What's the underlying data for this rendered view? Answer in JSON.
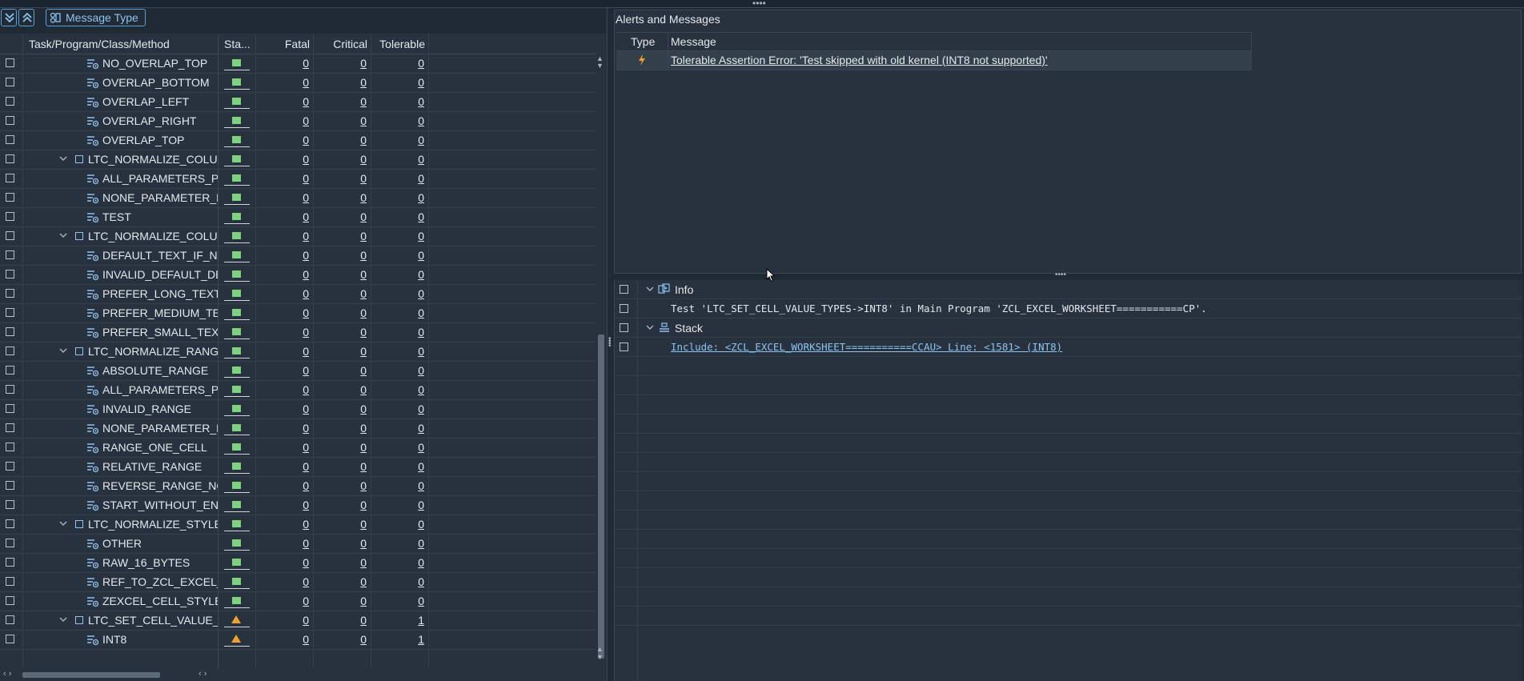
{
  "toolbar": {
    "expand_all_tooltip": "Expand all",
    "collapse_all_tooltip": "Collapse all",
    "message_type_label": "Message Type"
  },
  "tree": {
    "columns": {
      "task": "Task/Program/Class/Method",
      "status": "Sta...",
      "fatal": "Fatal",
      "critical": "Critical",
      "tolerable": "Tolerable"
    },
    "rows": [
      {
        "name": "NO_OVERLAP_TOP",
        "kind": "method",
        "status": "ok",
        "fatal": "0",
        "critical": "0",
        "tolerable": "0"
      },
      {
        "name": "OVERLAP_BOTTOM",
        "kind": "method",
        "status": "ok",
        "fatal": "0",
        "critical": "0",
        "tolerable": "0"
      },
      {
        "name": "OVERLAP_LEFT",
        "kind": "method",
        "status": "ok",
        "fatal": "0",
        "critical": "0",
        "tolerable": "0"
      },
      {
        "name": "OVERLAP_RIGHT",
        "kind": "method",
        "status": "ok",
        "fatal": "0",
        "critical": "0",
        "tolerable": "0"
      },
      {
        "name": "OVERLAP_TOP",
        "kind": "method",
        "status": "ok",
        "fatal": "0",
        "critical": "0",
        "tolerable": "0"
      },
      {
        "name": "LTC_NORMALIZE_COLUM",
        "kind": "class",
        "status": "ok",
        "fatal": "0",
        "critical": "0",
        "tolerable": "0"
      },
      {
        "name": "ALL_PARAMETERS_PA",
        "kind": "method",
        "status": "ok",
        "fatal": "0",
        "critical": "0",
        "tolerable": "0"
      },
      {
        "name": "NONE_PARAMETER_P",
        "kind": "method",
        "status": "ok",
        "fatal": "0",
        "critical": "0",
        "tolerable": "0"
      },
      {
        "name": "TEST",
        "kind": "method",
        "status": "ok",
        "fatal": "0",
        "critical": "0",
        "tolerable": "0"
      },
      {
        "name": "LTC_NORMALIZE_COLUM",
        "kind": "class",
        "status": "ok",
        "fatal": "0",
        "critical": "0",
        "tolerable": "0"
      },
      {
        "name": "DEFAULT_TEXT_IF_NO",
        "kind": "method",
        "status": "ok",
        "fatal": "0",
        "critical": "0",
        "tolerable": "0"
      },
      {
        "name": "INVALID_DEFAULT_DE",
        "kind": "method",
        "status": "ok",
        "fatal": "0",
        "critical": "0",
        "tolerable": "0"
      },
      {
        "name": "PREFER_LONG_TEXT",
        "kind": "method",
        "status": "ok",
        "fatal": "0",
        "critical": "0",
        "tolerable": "0"
      },
      {
        "name": "PREFER_MEDIUM_TEX",
        "kind": "method",
        "status": "ok",
        "fatal": "0",
        "critical": "0",
        "tolerable": "0"
      },
      {
        "name": "PREFER_SMALL_TEXT",
        "kind": "method",
        "status": "ok",
        "fatal": "0",
        "critical": "0",
        "tolerable": "0"
      },
      {
        "name": "LTC_NORMALIZE_RANGE",
        "kind": "class",
        "status": "ok",
        "fatal": "0",
        "critical": "0",
        "tolerable": "0"
      },
      {
        "name": "ABSOLUTE_RANGE",
        "kind": "method",
        "status": "ok",
        "fatal": "0",
        "critical": "0",
        "tolerable": "0"
      },
      {
        "name": "ALL_PARAMETERS_PA",
        "kind": "method",
        "status": "ok",
        "fatal": "0",
        "critical": "0",
        "tolerable": "0"
      },
      {
        "name": "INVALID_RANGE",
        "kind": "method",
        "status": "ok",
        "fatal": "0",
        "critical": "0",
        "tolerable": "0"
      },
      {
        "name": "NONE_PARAMETER_P",
        "kind": "method",
        "status": "ok",
        "fatal": "0",
        "critical": "0",
        "tolerable": "0"
      },
      {
        "name": "RANGE_ONE_CELL",
        "kind": "method",
        "status": "ok",
        "fatal": "0",
        "critical": "0",
        "tolerable": "0"
      },
      {
        "name": "RELATIVE_RANGE",
        "kind": "method",
        "status": "ok",
        "fatal": "0",
        "critical": "0",
        "tolerable": "0"
      },
      {
        "name": "REVERSE_RANGE_NOT",
        "kind": "method",
        "status": "ok",
        "fatal": "0",
        "critical": "0",
        "tolerable": "0"
      },
      {
        "name": "START_WITHOUT_END",
        "kind": "method",
        "status": "ok",
        "fatal": "0",
        "critical": "0",
        "tolerable": "0"
      },
      {
        "name": "LTC_NORMALIZE_STYLE",
        "kind": "class",
        "status": "ok",
        "fatal": "0",
        "critical": "0",
        "tolerable": "0"
      },
      {
        "name": "OTHER",
        "kind": "method",
        "status": "ok",
        "fatal": "0",
        "critical": "0",
        "tolerable": "0"
      },
      {
        "name": "RAW_16_BYTES",
        "kind": "method",
        "status": "ok",
        "fatal": "0",
        "critical": "0",
        "tolerable": "0"
      },
      {
        "name": "REF_TO_ZCL_EXCEL_S",
        "kind": "method",
        "status": "ok",
        "fatal": "0",
        "critical": "0",
        "tolerable": "0"
      },
      {
        "name": "ZEXCEL_CELL_STYLE",
        "kind": "method",
        "status": "ok",
        "fatal": "0",
        "critical": "0",
        "tolerable": "0"
      },
      {
        "name": "LTC_SET_CELL_VALUE_T",
        "kind": "class",
        "status": "warning",
        "fatal": "0",
        "critical": "0",
        "tolerable": "1"
      },
      {
        "name": "INT8",
        "kind": "method",
        "status": "warning",
        "fatal": "0",
        "critical": "0",
        "tolerable": "1"
      }
    ]
  },
  "alerts": {
    "title": "Alerts and Messages",
    "columns": {
      "type": "Type",
      "message": "Message"
    },
    "rows": [
      {
        "type_icon": "lightning-icon",
        "message": "Tolerable Assertion Error: 'Test skipped with old kernel (INT8 not supported)'"
      }
    ]
  },
  "details": {
    "info_label": "Info",
    "info_text": "Test 'LTC_SET_CELL_VALUE_TYPES->INT8' in Main Program 'ZCL_EXCEL_WORKSHEET===========CP'.",
    "stack_label": "Stack",
    "stack_text": "Include: <ZCL_EXCEL_WORKSHEET===========CCAU> Line: <1581> (INT8)"
  },
  "colors": {
    "background": "#1f2a35",
    "panel": "#27323e",
    "accent": "#8ec3ee",
    "ok": "#7fd17f",
    "warning": "#f0a030"
  }
}
